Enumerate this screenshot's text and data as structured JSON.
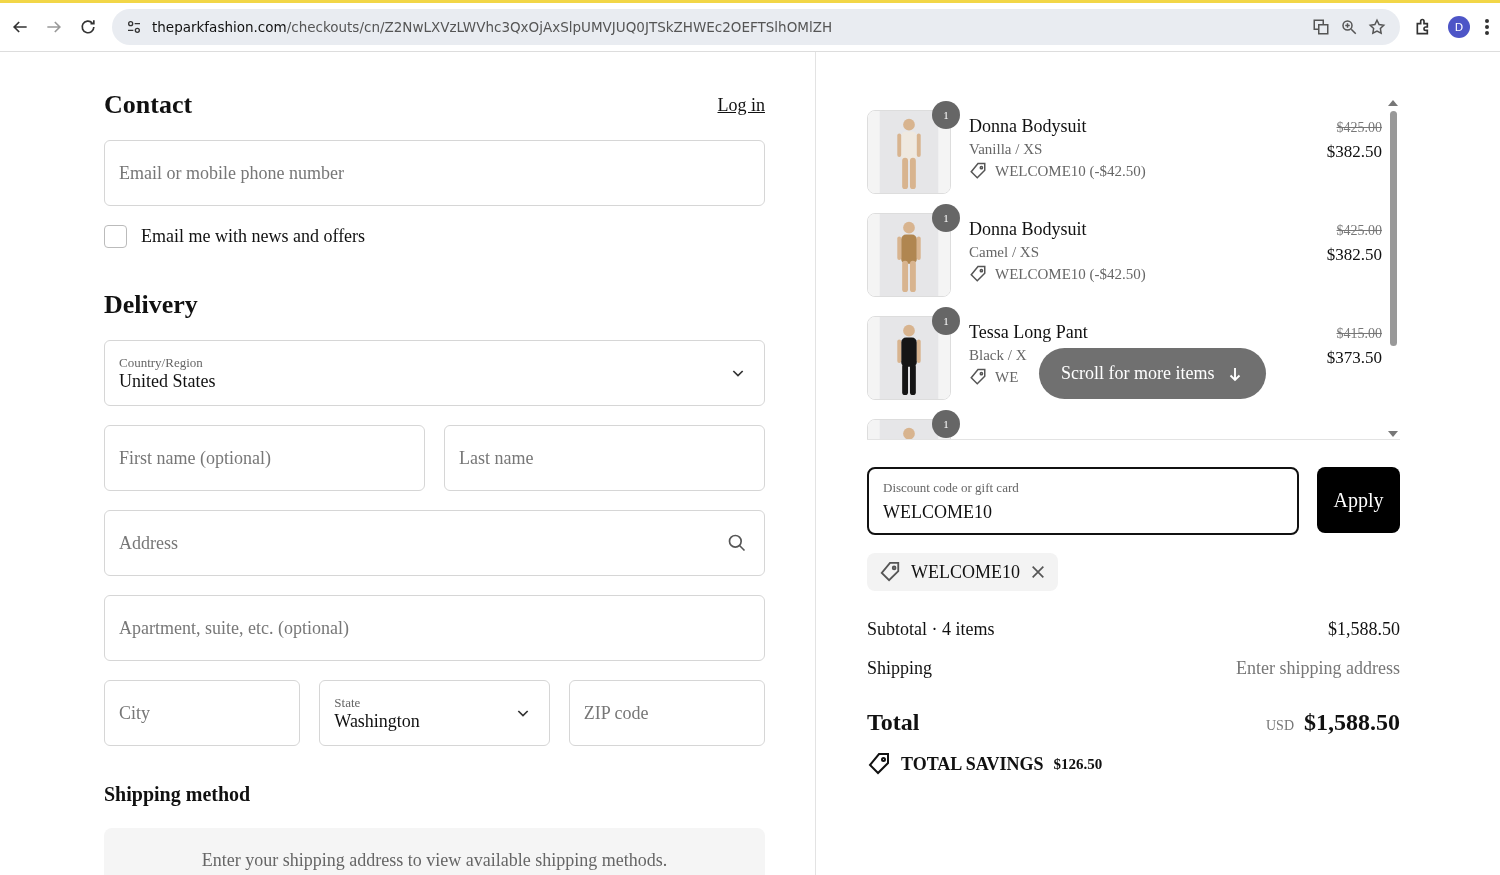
{
  "browser": {
    "url_domain": "theparkfashion.com",
    "url_path": "/checkouts/cn/Z2NwLXVzLWVhc3QxOjAxSlpUMVJUQ0JTSkZHWEc2OEFTSlhOMlZH",
    "profile_initial": "D"
  },
  "contact": {
    "title": "Contact",
    "login_link": "Log in",
    "email_placeholder": "Email or mobile phone number",
    "newsletter": {
      "label": "Email me with news and offers",
      "checked": false
    }
  },
  "delivery": {
    "title": "Delivery",
    "country": {
      "label": "Country/Region",
      "value": "United States"
    },
    "first_name_placeholder": "First name (optional)",
    "last_name_placeholder": "Last name",
    "address_placeholder": "Address",
    "apartment_placeholder": "Apartment, suite, etc. (optional)",
    "city_placeholder": "City",
    "state": {
      "label": "State",
      "value": "Washington"
    },
    "zip_placeholder": "ZIP code"
  },
  "shipping_method": {
    "title": "Shipping method",
    "message": "Enter your shipping address to view available shipping methods."
  },
  "order": {
    "items": [
      {
        "name": "Donna Bodysuit",
        "variant": "Vanilla / XS",
        "discount": "WELCOME10 (-$42.50)",
        "compare_price": "$425.00",
        "price": "$382.50",
        "quantity": "1"
      },
      {
        "name": "Donna Bodysuit",
        "variant": "Camel / XS",
        "discount": "WELCOME10 (-$42.50)",
        "compare_price": "$425.00",
        "price": "$382.50",
        "quantity": "1"
      },
      {
        "name": "Tessa Long Pant",
        "variant": "Black / X",
        "discount": "WE",
        "compare_price": "$415.00",
        "price": "$373.50",
        "quantity": "1"
      }
    ],
    "partial_item_quantity": "1",
    "scroll_hint": "Scroll for more items"
  },
  "discount": {
    "label": "Discount code or gift card",
    "value": "WELCOME10",
    "button": "Apply",
    "applied_code": "WELCOME10"
  },
  "summary": {
    "subtotal_label": "Subtotal · 4 items",
    "subtotal": "$1,588.50",
    "shipping_label": "Shipping",
    "shipping_value": "Enter shipping address",
    "total_label": "Total",
    "currency": "USD",
    "total": "$1,588.50",
    "savings_label": "TOTAL SAVINGS",
    "savings": "$126.50"
  }
}
